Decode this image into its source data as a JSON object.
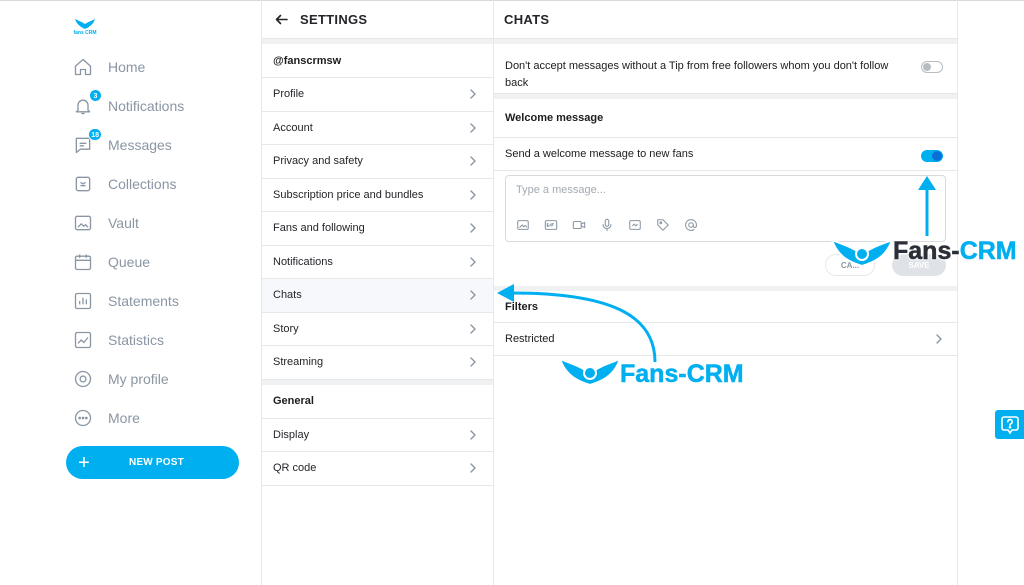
{
  "brand": {
    "text": "fans CRM"
  },
  "colors": {
    "accent": "#00aff0",
    "toggle_knob": "#0a6fd6",
    "text_muted": "#8a96a3"
  },
  "sidebar": {
    "items": [
      {
        "label": "Home",
        "icon": "home-icon"
      },
      {
        "label": "Notifications",
        "icon": "bell-icon",
        "badge": "3"
      },
      {
        "label": "Messages",
        "icon": "message-icon",
        "badge": "18"
      },
      {
        "label": "Collections",
        "icon": "bookmark-icon"
      },
      {
        "label": "Vault",
        "icon": "image-icon"
      },
      {
        "label": "Queue",
        "icon": "calendar-icon"
      },
      {
        "label": "Statements",
        "icon": "bar-chart-icon"
      },
      {
        "label": "Statistics",
        "icon": "line-chart-icon"
      },
      {
        "label": "My profile",
        "icon": "user-circle-icon"
      },
      {
        "label": "More",
        "icon": "more-icon"
      }
    ],
    "new_post_label": "NEW POST"
  },
  "settings": {
    "title": "SETTINGS",
    "username": "@fanscrmsw",
    "items": [
      "Profile",
      "Account",
      "Privacy and safety",
      "Subscription price and bundles",
      "Fans and following",
      "Notifications",
      "Chats",
      "Story",
      "Streaming"
    ],
    "active_item": "Chats",
    "general_title": "General",
    "general_items": [
      "Display",
      "QR code"
    ]
  },
  "chats": {
    "title": "CHATS",
    "tip_toggle": {
      "label": "Don't accept messages without a Tip from free followers whom you don't follow back",
      "on": false
    },
    "welcome": {
      "section_title": "Welcome message",
      "toggle_label": "Send a welcome message to new fans",
      "on": true,
      "placeholder": "Type a message...",
      "cancel_label": "CA...",
      "save_label": "SAVE"
    },
    "filters": {
      "section_title": "Filters",
      "items": [
        "Restricted"
      ]
    }
  },
  "watermark": {
    "text_dark": "Fans-",
    "text_blue": "CRM"
  }
}
